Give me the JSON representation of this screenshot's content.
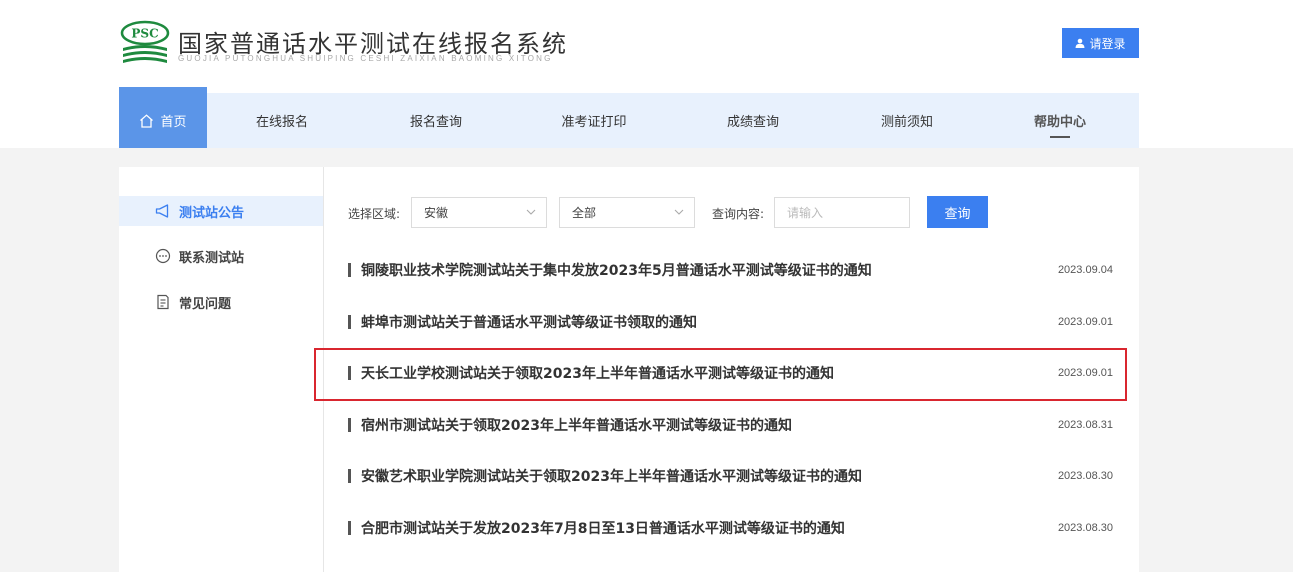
{
  "header": {
    "logo_text": "PSC",
    "title": "国家普通话水平测试在线报名系统",
    "subtitle": "GUOJIA PUTONGHUA SHUIPING CESHI ZAIXIAN BAOMING XITONG",
    "login_label": "请登录",
    "brand_color": "#3b7ff0",
    "logo_color": "#1e8a3e"
  },
  "nav": {
    "items": [
      {
        "label": "首页",
        "icon": "home-icon",
        "active": true
      },
      {
        "label": "在线报名"
      },
      {
        "label": "报名查询"
      },
      {
        "label": "准考证打印"
      },
      {
        "label": "成绩查询"
      },
      {
        "label": "测前须知"
      },
      {
        "label": "帮助中心"
      }
    ]
  },
  "sidebar": {
    "items": [
      {
        "label": "测试站公告",
        "icon": "megaphone-icon",
        "active": true
      },
      {
        "label": "联系测试站",
        "icon": "chat-bubble-icon"
      },
      {
        "label": "常见问题",
        "icon": "document-icon"
      }
    ]
  },
  "filter": {
    "region_label": "选择区域:",
    "region_value": "安徽",
    "scope_value": "全部",
    "query_label": "查询内容:",
    "query_placeholder": "请输入",
    "query_button": "查询"
  },
  "notices": [
    {
      "title": "铜陵职业技术学院测试站关于集中发放2023年5月普通话水平测试等级证书的通知",
      "date": "2023.09.04"
    },
    {
      "title": "蚌埠市测试站关于普通话水平测试等级证书领取的通知",
      "date": "2023.09.01"
    },
    {
      "title": "天长工业学校测试站关于领取2023年上半年普通话水平测试等级证书的通知",
      "date": "2023.09.01",
      "highlighted": true
    },
    {
      "title": "宿州市测试站关于领取2023年上半年普通话水平测试等级证书的通知",
      "date": "2023.08.31"
    },
    {
      "title": "安徽艺术职业学院测试站关于领取2023年上半年普通话水平测试等级证书的通知",
      "date": "2023.08.30"
    },
    {
      "title": "合肥市测试站关于发放2023年7月8日至13日普通话水平测试等级证书的通知",
      "date": "2023.08.30"
    }
  ]
}
